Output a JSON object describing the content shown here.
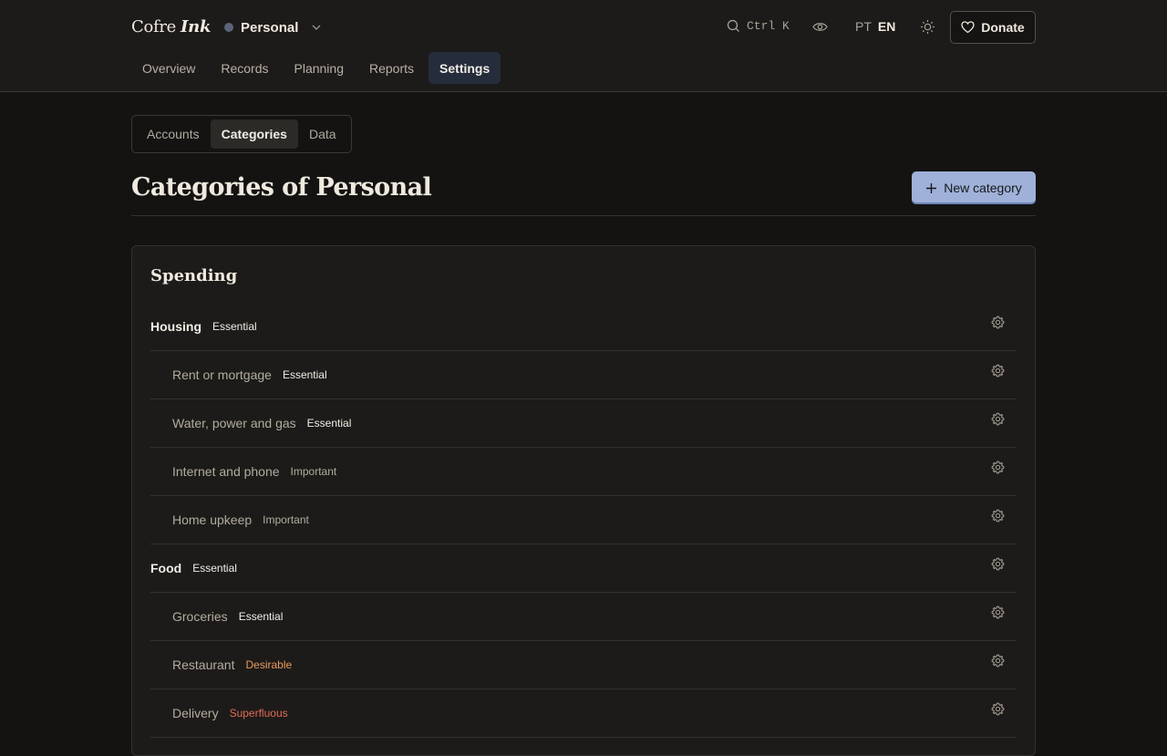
{
  "app": {
    "brand_main": "Cofre",
    "brand_accent": "Ink"
  },
  "book": {
    "name": "Personal"
  },
  "search": {
    "shortcut": "Ctrl K"
  },
  "lang": {
    "pt": "PT",
    "en": "EN"
  },
  "donate": {
    "label": "Donate"
  },
  "nav": {
    "tabs": [
      {
        "label": "Overview"
      },
      {
        "label": "Records"
      },
      {
        "label": "Planning"
      },
      {
        "label": "Reports"
      },
      {
        "label": "Settings",
        "active": true
      }
    ]
  },
  "subtabs": [
    {
      "label": "Accounts"
    },
    {
      "label": "Categories",
      "active": true
    },
    {
      "label": "Data"
    }
  ],
  "page": {
    "title": "Categories of Personal",
    "new_button": "New category"
  },
  "section": {
    "title": "Spending",
    "rows": [
      {
        "name": "Housing",
        "tag": "Essential",
        "level": "parent",
        "tag_kind": "essential"
      },
      {
        "name": "Rent or mortgage",
        "tag": "Essential",
        "level": "child",
        "tag_kind": "essential"
      },
      {
        "name": "Water, power and gas",
        "tag": "Essential",
        "level": "child",
        "tag_kind": "essential"
      },
      {
        "name": "Internet and phone",
        "tag": "Important",
        "level": "child",
        "tag_kind": "important"
      },
      {
        "name": "Home upkeep",
        "tag": "Important",
        "level": "child",
        "tag_kind": "important"
      },
      {
        "name": "Food",
        "tag": "Essential",
        "level": "parent",
        "tag_kind": "essential"
      },
      {
        "name": "Groceries",
        "tag": "Essential",
        "level": "child",
        "tag_kind": "essential"
      },
      {
        "name": "Restaurant",
        "tag": "Desirable",
        "level": "child",
        "tag_kind": "desirable"
      },
      {
        "name": "Delivery",
        "tag": "Superfluous",
        "level": "child",
        "tag_kind": "superfluous"
      }
    ]
  },
  "colors": {
    "accent": "#9fb1d8",
    "desirable": "#e79a5c",
    "superfluous": "#e06b58",
    "book_dot": "#5b6478"
  },
  "icons": [
    "search-icon",
    "eye-icon",
    "sun-icon",
    "heart-icon",
    "plus-icon",
    "gear-icon",
    "chevron-down-icon"
  ]
}
